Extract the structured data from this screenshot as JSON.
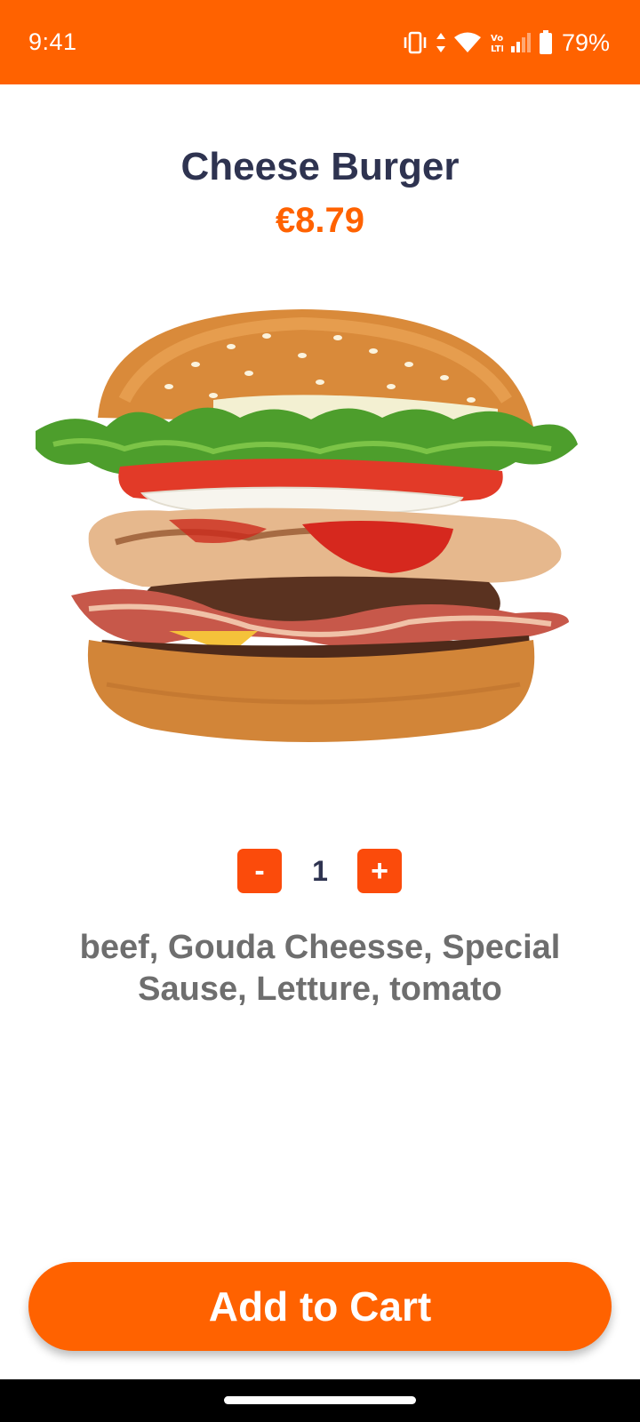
{
  "status_bar": {
    "time": "9:41",
    "battery": "79%",
    "background": "#ff6200"
  },
  "product": {
    "title": "Cheese Burger",
    "price": "€8.79",
    "image_icon": "burger-image",
    "quantity": "1",
    "minus_label": "-",
    "plus_label": "+",
    "ingredients": "beef, Gouda Cheesse, Special Sause, Letture, tomato"
  },
  "actions": {
    "add_to_cart": "Add to Cart"
  },
  "colors": {
    "accent": "#ff6200",
    "title": "#2e3350",
    "body_text": "#6e6e6e",
    "qty_button": "#fb4b0b"
  }
}
